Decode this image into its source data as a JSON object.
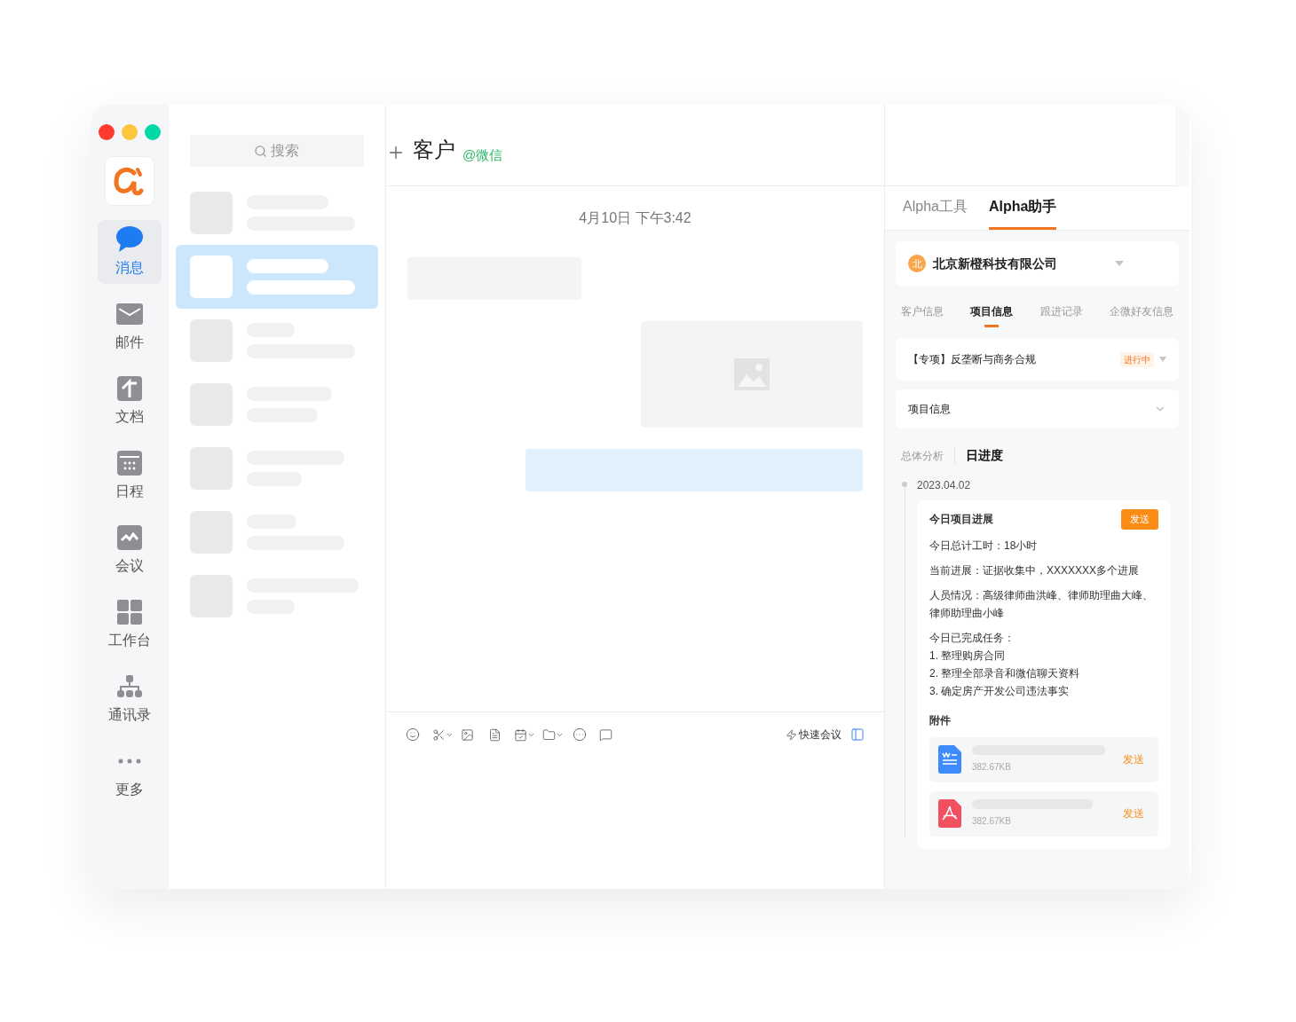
{
  "nav": [
    {
      "label": "消息",
      "selected": true
    },
    {
      "label": "邮件",
      "selected": false
    },
    {
      "label": "文档",
      "selected": false
    },
    {
      "label": "日程",
      "selected": false
    },
    {
      "label": "会议",
      "selected": false
    },
    {
      "label": "工作台",
      "selected": false
    },
    {
      "label": "通讯录",
      "selected": false
    },
    {
      "label": "更多",
      "selected": false
    }
  ],
  "search": {
    "placeholder": "搜索"
  },
  "conversations": [
    {
      "selected": false
    },
    {
      "selected": true
    },
    {
      "selected": false
    },
    {
      "selected": false
    },
    {
      "selected": false
    },
    {
      "selected": false
    },
    {
      "selected": false
    }
  ],
  "chat": {
    "title": "客户",
    "source": "@微信",
    "timestamp": "4月10日 下午3:42",
    "quick_meeting": "快速会议"
  },
  "panel": {
    "tabs": [
      {
        "label": "Alpha工具",
        "selected": false
      },
      {
        "label": "Alpha助手",
        "selected": true
      }
    ],
    "company": {
      "avatar": "北",
      "name": "北京新橙科技有限公司"
    },
    "subtabs": [
      {
        "label": "客户信息",
        "selected": false
      },
      {
        "label": "项目信息",
        "selected": true
      },
      {
        "label": "跟进记录",
        "selected": false
      },
      {
        "label": "企微好友信息",
        "selected": false
      }
    ],
    "project": {
      "name": "【专项】反垄断与商务合规",
      "status": "进行中"
    },
    "section": "项目信息",
    "views": [
      {
        "label": "总体分析",
        "selected": false
      },
      {
        "label": "日进度",
        "selected": true
      }
    ],
    "date": "2023.04.02",
    "report": {
      "title": "今日项目进展",
      "send": "发送",
      "lines": [
        "今日总计工时：18小时",
        "当前进展：证据收集中，XXXXXXX多个进展",
        "人员情况：高级律师曲洪峰、律师助理曲大峰、律师助理曲小峰"
      ],
      "tasks_title": "今日已完成任务：",
      "tasks": [
        "1. 整理购房合同",
        "2. 整理全部录音和微信聊天资料",
        "3. 确定房产开发公司违法事实"
      ],
      "attachments_title": "附件",
      "attachments": [
        {
          "kind": "word",
          "size": "382.67KB",
          "send": "发送"
        },
        {
          "kind": "pdf",
          "size": "382.67KB",
          "send": "发送"
        }
      ]
    }
  }
}
